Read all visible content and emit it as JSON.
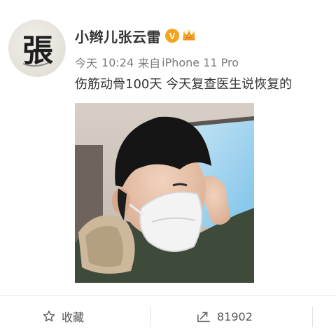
{
  "post": {
    "author": {
      "name": "小辫儿张云雷",
      "verified_badge": "V",
      "verified_color": "#f7a21b",
      "avatar_glyph": "張",
      "avatar_icon": "calligraphy-avatar"
    },
    "meta": {
      "day": "今天",
      "time": "10:24",
      "source_prefix": "来自",
      "device": "iPhone 11 Pro"
    },
    "text": "伤筋动骨100天 今天复查医生说恢复的",
    "image": {
      "icon": "photo-man-in-mask-in-car"
    }
  },
  "actions": {
    "favorite": {
      "label": "收藏",
      "icon": "star-outline-icon"
    },
    "repost": {
      "count": "81902",
      "icon": "repost-icon"
    }
  },
  "colors": {
    "text_primary": "#333333",
    "text_secondary": "#7a7a7a",
    "divider": "#ececec"
  }
}
